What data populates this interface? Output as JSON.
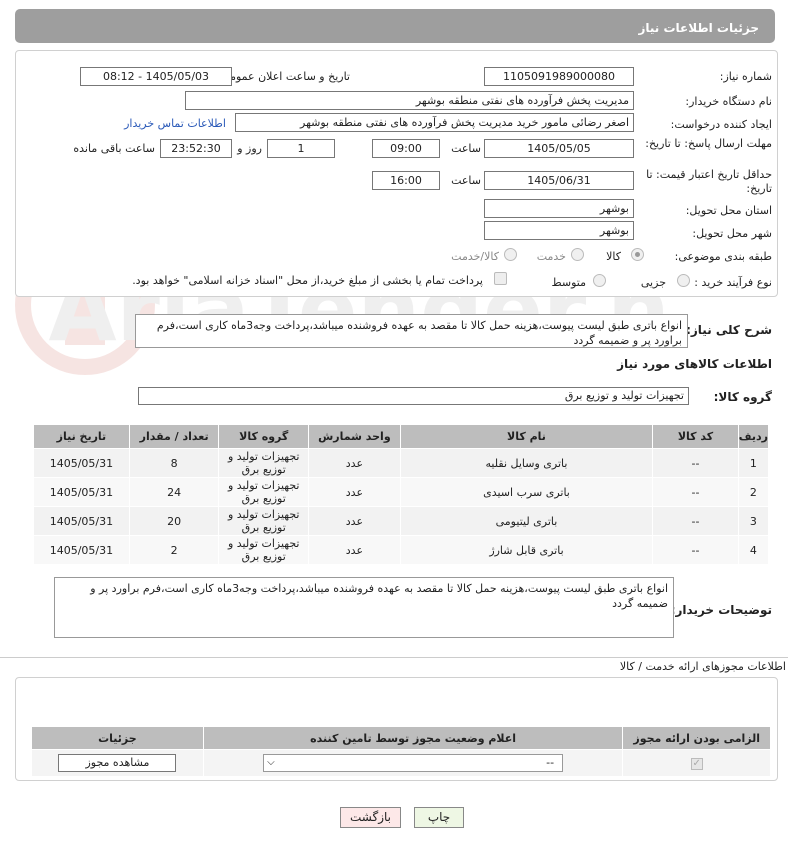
{
  "header": {
    "title": "جزئیات اطلاعات نیاز"
  },
  "form": {
    "need_number_label": "شماره نیاز:",
    "need_number": "1105091989000080",
    "announce_label": "تاریخ و ساعت اعلان عمومی:",
    "announce_value": "1405/05/03 - 08:12",
    "buyer_org_label": "نام دستگاه خریدار:",
    "buyer_org": "مدیریت پخش فرآورده های نفتی منطقه بوشهر",
    "creator_label": "ایجاد کننده درخواست:",
    "creator": "اصغر رضائی مامور خرید مدیریت پخش فرآورده های نفتی منطقه بوشهر",
    "contact_link": "اطلاعات تماس خریدار",
    "deadline_label": "مهلت ارسال پاسخ: تا تاریخ:",
    "deadline_date": "1405/05/05",
    "time_label": "ساعت",
    "deadline_time": "09:00",
    "days_value": "1",
    "days_label": "روز و",
    "remaining_time": "23:52:30",
    "remaining_label": "ساعت باقی مانده",
    "validity_label": "حداقل تاریخ اعتبار قیمت: تا تاریخ:",
    "validity_date": "1405/06/31",
    "validity_time": "16:00",
    "province_label": "استان محل تحویل:",
    "province": "بوشهر",
    "city_label": "شهر محل تحویل:",
    "city": "بوشهر",
    "category_label": "طبقه بندی موضوعی:",
    "category_options": [
      "کالا",
      "خدمت",
      "کالا/خدمت"
    ],
    "process_label": "نوع فرآیند خرید :",
    "process_options": [
      "جزیی",
      "متوسط"
    ],
    "payment_note": "پرداخت تمام یا بخشی از مبلغ خرید،از محل \"اسناد خزانه اسلامی\" خواهد بود."
  },
  "summary": {
    "label": "شرح کلی نیاز:",
    "text": "انواع باتری طبق لیست پیوست،هزینه حمل کالا تا مقصد به عهده فروشنده میباشد،پرداخت وجه3ماه کاری است،فرم براورد پر و ضمیمه گردد"
  },
  "goods": {
    "section_title": "اطلاعات کالاهای مورد نیاز",
    "group_label": "گروه کالا:",
    "group_value": "تجهیزات تولید و توزیع برق",
    "columns": [
      "ردیف",
      "کد کالا",
      "نام کالا",
      "واحد شمارش",
      "گروه کالا",
      "تعداد / مقدار",
      "تاریخ نیاز"
    ],
    "rows": [
      {
        "idx": "1",
        "code": "--",
        "name": "باتری وسایل نقلیه",
        "unit": "عدد",
        "group": "تجهیزات تولید و توزیع برق",
        "qty": "8",
        "date": "1405/05/31"
      },
      {
        "idx": "2",
        "code": "--",
        "name": "باتری سرب اسیدی",
        "unit": "عدد",
        "group": "تجهیزات تولید و توزیع برق",
        "qty": "24",
        "date": "1405/05/31"
      },
      {
        "idx": "3",
        "code": "--",
        "name": "باتری لیتیومی",
        "unit": "عدد",
        "group": "تجهیزات تولید و توزیع برق",
        "qty": "20",
        "date": "1405/05/31"
      },
      {
        "idx": "4",
        "code": "--",
        "name": "باتری قابل شارژ",
        "unit": "عدد",
        "group": "تجهیزات تولید و توزیع برق",
        "qty": "2",
        "date": "1405/05/31"
      }
    ]
  },
  "buyer_notes": {
    "label": "توضیحات خریدار:",
    "text": "انواع باتری طبق لیست پیوست،هزینه حمل کالا تا مقصد به عهده فروشنده میباشد،پرداخت وجه3ماه کاری است،فرم براورد پر و ضمیمه گردد"
  },
  "licenses": {
    "section_title": "اطلاعات مجوزهای ارائه خدمت / کالا",
    "columns": [
      "الزامی بودن ارائه مجوز",
      "اعلام وضعیت مجوز توسط تامین کننده",
      "جزئیات"
    ],
    "select_value": "--",
    "view_button": "مشاهده مجوز"
  },
  "footer": {
    "print": "چاپ",
    "back": "بازگشت"
  },
  "watermark": "AriaTender.net"
}
